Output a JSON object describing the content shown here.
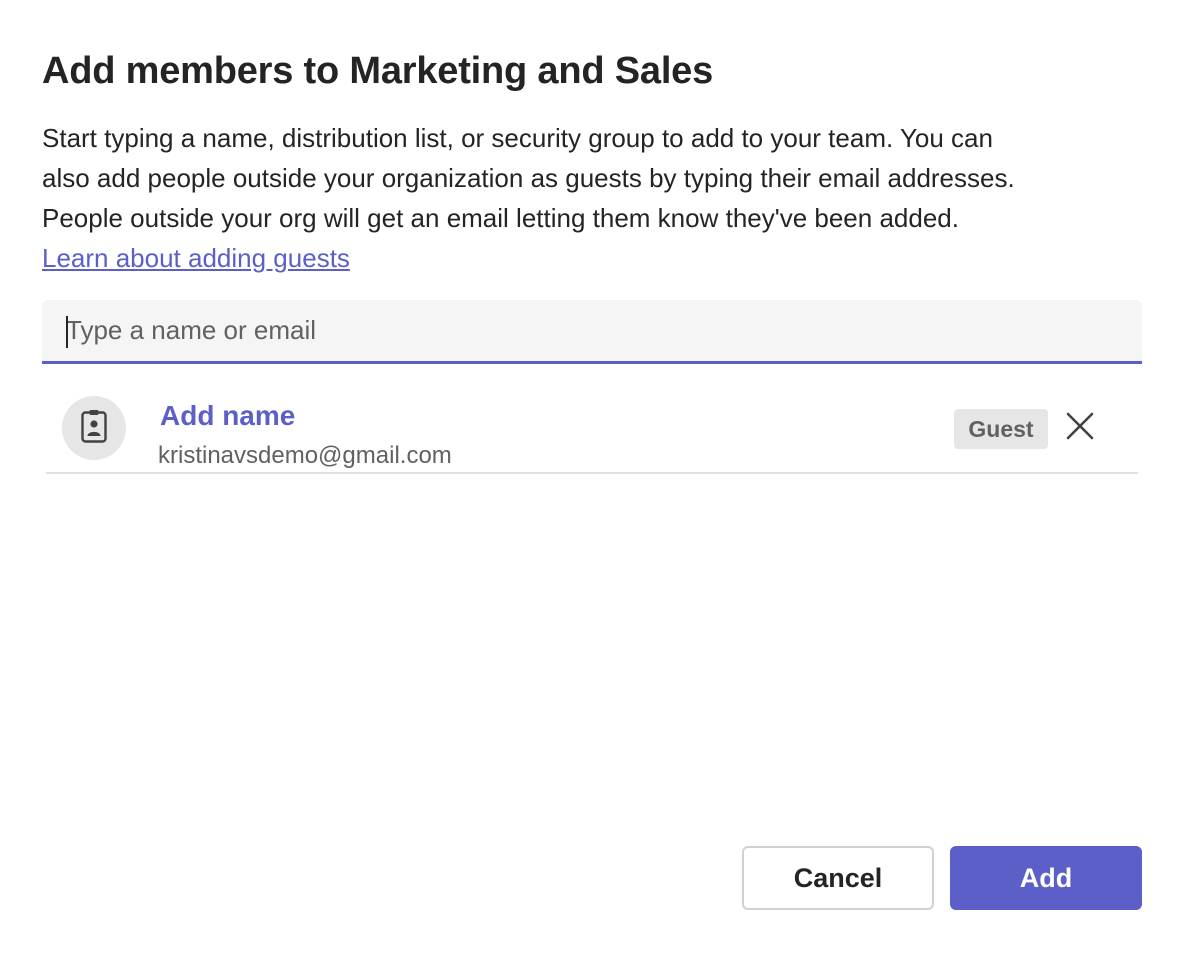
{
  "dialog": {
    "title": "Add members to Marketing and Sales",
    "description_lines": [
      "Start typing a name, distribution list, or security group to add to your team. You can",
      "also add people outside your organization as guests by typing their email addresses.",
      "People outside your org will get an email letting them know they've been added."
    ],
    "learn_link": "Learn about adding guests"
  },
  "search": {
    "placeholder": "Type a name or email",
    "value": ""
  },
  "members": [
    {
      "name": "Add name",
      "email": "kristinavsdemo@gmail.com",
      "badge": "Guest",
      "avatar_icon": "id-badge-icon",
      "remove_icon": "close-icon"
    }
  ],
  "actions": {
    "cancel_label": "Cancel",
    "add_label": "Add"
  },
  "colors": {
    "accent": "#5b5fc7",
    "text": "#242424",
    "secondary_text": "#616161",
    "field_background": "#f5f5f5",
    "badge_background": "#e6e6e6"
  }
}
